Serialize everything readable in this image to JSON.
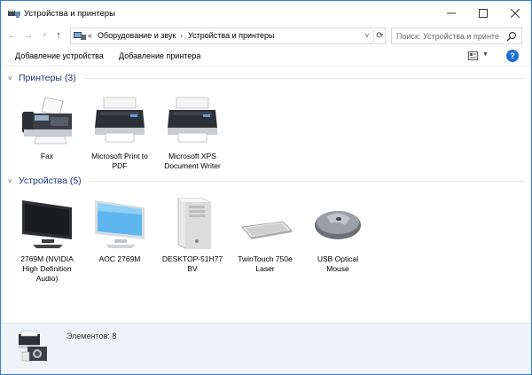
{
  "window": {
    "title": "Устройства и принтеры"
  },
  "navigation": {
    "back": "←",
    "forward": "→",
    "recent": "˅",
    "up": "↑",
    "crumb_prefix": "«",
    "breadcrumbs": [
      "Оборудование и звук",
      "Устройства и принтеры"
    ],
    "separator": "›",
    "search_placeholder": "Поиск: Устройства и принте"
  },
  "toolbar": {
    "add_device": "Добавление устройства",
    "add_printer": "Добавление принтера",
    "help": "?"
  },
  "groups": [
    {
      "title": "Принтеры (3)",
      "items": [
        {
          "label": "Fax",
          "icon": "fax-icon"
        },
        {
          "label": "Microsoft Print to PDF",
          "icon": "printer-icon"
        },
        {
          "label": "Microsoft XPS Document Writer",
          "icon": "printer-icon"
        }
      ]
    },
    {
      "title": "Устройства (5)",
      "items": [
        {
          "label": "2769M (NVIDIA High Definition Audio)",
          "icon": "monitor-dark-icon"
        },
        {
          "label": "AOC 2769M",
          "icon": "monitor-blue-icon"
        },
        {
          "label": "DESKTOP-51H77 BV",
          "icon": "computer-tower-icon"
        },
        {
          "label": "TwinTouch 750e Laser",
          "icon": "keyboard-icon"
        },
        {
          "label": "USB Optical Mouse",
          "icon": "mouse-icon"
        }
      ]
    }
  ],
  "details": {
    "count_text": "Элементов: 8"
  },
  "colors": {
    "accent": "#1d6fd0",
    "group_title": "#1e3287",
    "window_border": "#2b7fd6"
  }
}
